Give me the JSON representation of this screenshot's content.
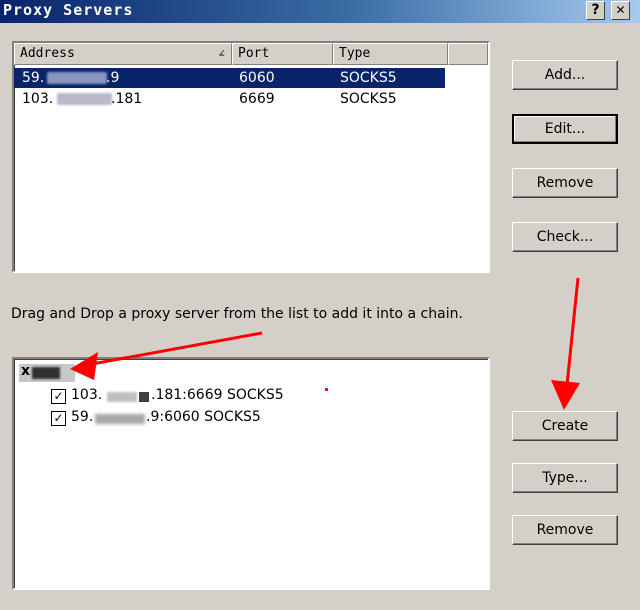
{
  "window": {
    "title": "Proxy Servers",
    "help_label": "?",
    "close_label": "✕"
  },
  "table": {
    "columns": [
      {
        "label": "Address",
        "sort": "∠"
      },
      {
        "label": "Port"
      },
      {
        "label": "Type"
      }
    ],
    "rows": [
      {
        "address_start": "59.",
        "address_end": ".9",
        "port": "6060",
        "type": "SOCKS5",
        "selected": true
      },
      {
        "address_start": "103.",
        "address_end": ".181",
        "port": "6669",
        "type": "SOCKS5",
        "selected": false
      }
    ]
  },
  "buttons_top": {
    "add": "Add...",
    "edit": "Edit...",
    "remove": "Remove",
    "check": "Check..."
  },
  "instruction": "Drag and Drop a proxy server from the list to add it into a chain.",
  "chain": {
    "root_prefix": "x",
    "items": [
      {
        "checked": true,
        "text_start": "103.",
        "text_end": ".181:6669 SOCKS5"
      },
      {
        "checked": true,
        "text_start": "59.",
        "text_end": ".9:6060 SOCKS5"
      }
    ]
  },
  "buttons_bottom": {
    "create": "Create",
    "type": "Type...",
    "remove": "Remove"
  },
  "colors": {
    "selection": "#0a246a",
    "annotation_arrow": "#ff0000"
  }
}
